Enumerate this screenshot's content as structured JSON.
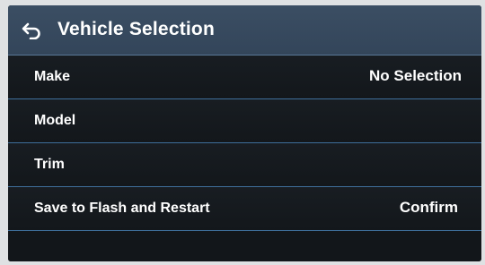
{
  "header": {
    "back_icon": "back-arrow-icon",
    "title": "Vehicle Selection"
  },
  "rows": [
    {
      "label": "Make",
      "value": "No Selection"
    },
    {
      "label": "Model",
      "value": ""
    },
    {
      "label": "Trim",
      "value": ""
    },
    {
      "label": "Save to Flash and Restart",
      "value": "Confirm"
    }
  ],
  "colors": {
    "header_bg": "#3b4e63",
    "screen_bg": "#111519",
    "divider": "#3f6f9c",
    "text": "#ffffff"
  }
}
